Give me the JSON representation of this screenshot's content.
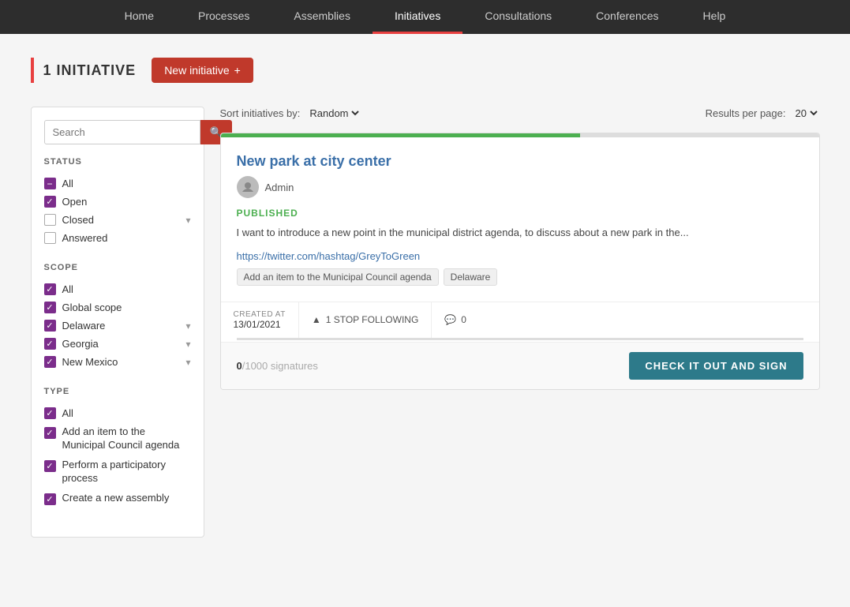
{
  "nav": {
    "items": [
      {
        "label": "Home",
        "active": false
      },
      {
        "label": "Processes",
        "active": false
      },
      {
        "label": "Assemblies",
        "active": false
      },
      {
        "label": "Initiatives",
        "active": true
      },
      {
        "label": "Consultations",
        "active": false
      },
      {
        "label": "Conferences",
        "active": false
      },
      {
        "label": "Help",
        "active": false
      }
    ]
  },
  "header": {
    "count_label": "1 INITIATIVE",
    "new_button": "New initiative",
    "new_button_icon": "+"
  },
  "sidebar": {
    "search_placeholder": "Search",
    "status_label": "STATUS",
    "status_items": [
      {
        "label": "All",
        "state": "minus"
      },
      {
        "label": "Open",
        "state": "checked"
      },
      {
        "label": "Closed",
        "state": "empty",
        "has_chevron": true
      },
      {
        "label": "Answered",
        "state": "empty"
      }
    ],
    "scope_label": "SCOPE",
    "scope_items": [
      {
        "label": "All",
        "state": "checked"
      },
      {
        "label": "Global scope",
        "state": "checked"
      },
      {
        "label": "Delaware",
        "state": "checked",
        "has_chevron": true
      },
      {
        "label": "Georgia",
        "state": "checked",
        "has_chevron": true
      },
      {
        "label": "New Mexico",
        "state": "checked",
        "has_chevron": true
      }
    ],
    "type_label": "TYPE",
    "type_items": [
      {
        "label": "All",
        "state": "checked"
      },
      {
        "label": "Add an item to the Municipal Council agenda",
        "state": "checked"
      },
      {
        "label": "Perform a participatory process",
        "state": "checked"
      },
      {
        "label": "Create a new assembly",
        "state": "checked"
      }
    ]
  },
  "sort": {
    "label": "Sort initiatives by:",
    "value": "Random",
    "arrow": "▾",
    "results_label": "Results per page:",
    "results_value": "20",
    "results_arrow": "▾"
  },
  "card": {
    "title": "New park at city center",
    "author": "Admin",
    "status": "PUBLISHED",
    "description": "I want to introduce a new point in the municipal district agenda, to discuss about a new park in the...",
    "link": "https://twitter.com/hashtag/GreyToGreen",
    "tags": [
      "Add an item to the Municipal Council agenda",
      "Delaware"
    ],
    "created_label": "CREATED AT",
    "created_date": "13/01/2021",
    "follow_label": "1 STOP FOLLOWING",
    "follow_icon": "▲",
    "comment_count": "0",
    "comment_icon": "💬",
    "signatures_current": "0",
    "signatures_total": "1000",
    "signatures_label": "/1000 signatures",
    "cta_button": "CHECK IT OUT AND SIGN",
    "progress": 0
  }
}
